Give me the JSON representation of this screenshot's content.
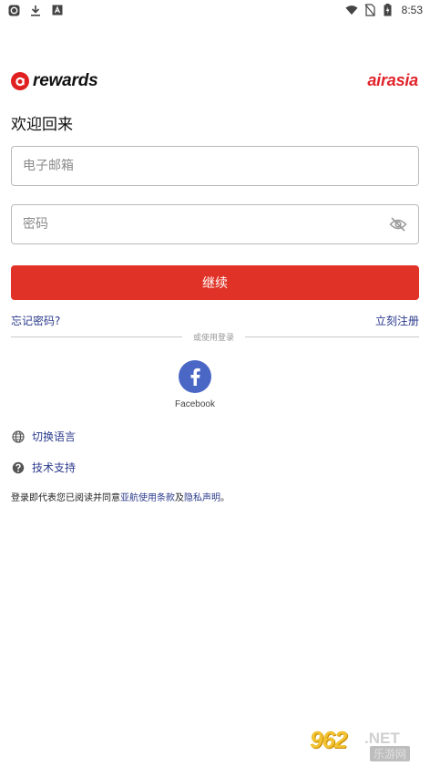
{
  "status_bar": {
    "time": "8:53",
    "left_icons": [
      "app-badge-icon",
      "download-icon",
      "keyboard-icon"
    ],
    "right_icons": [
      "wifi-icon",
      "no-sim-icon",
      "battery-charging-icon"
    ]
  },
  "header": {
    "rewards_logo": "rewards",
    "airasia_logo": "airasia",
    "brand_color": "#e0232a"
  },
  "page_title": "欢迎回来",
  "form": {
    "email_placeholder": "电子邮箱",
    "email_value": "",
    "password_placeholder": "密码",
    "password_value": "",
    "continue_label": "继续",
    "button_color": "#e03226"
  },
  "links": {
    "forgot_password": "忘记密码?",
    "sign_up": "立刻注册",
    "link_color": "#2b3a8c"
  },
  "divider_text": "或使用登录",
  "social": {
    "facebook_label": "Facebook",
    "facebook_color": "#4a67c6"
  },
  "options": {
    "switch_language": "切换语言",
    "tech_support": "技术支持"
  },
  "terms": {
    "prefix": "登录即代表您已阅读并同意",
    "terms_link": "亚航使用条款",
    "and": "及",
    "privacy_link": "隐私声明",
    "suffix": "。"
  },
  "watermark": {
    "number": "962",
    "net": ".NET",
    "cn": "乐游网"
  }
}
